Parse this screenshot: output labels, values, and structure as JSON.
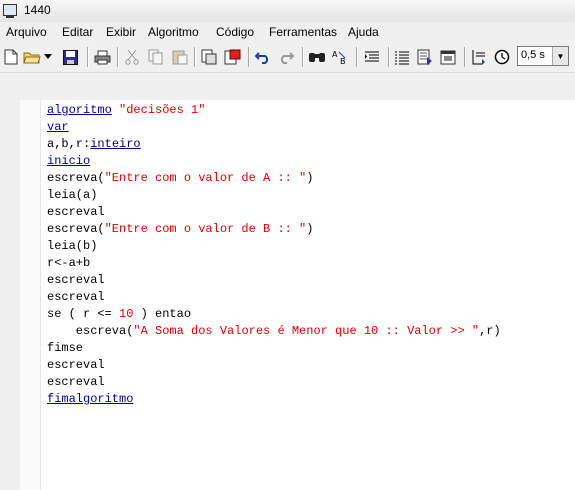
{
  "window": {
    "title": "1440"
  },
  "menu": [
    "Arquivo",
    "Editar",
    "Exibir",
    "Algoritmo",
    "Código",
    "Ferramentas",
    "Ajuda"
  ],
  "toolbar": {
    "icons": [
      "new-file-icon",
      "open-folder-icon",
      "dropdown-arrow-icon",
      "save-icon",
      "print-icon",
      "cut-icon",
      "copy-icon",
      "paste-icon",
      "copy-special-icon",
      "paste-special-icon",
      "undo-icon",
      "redo-icon",
      "find-icon",
      "replace-icon",
      "indent-icon",
      "list-icon",
      "export-icon",
      "window-icon",
      "step-icon",
      "timer-icon"
    ],
    "speed_value": "0,5 s"
  },
  "code": {
    "l1": {
      "kw": "algoritmo",
      "str": "\"decisões 1\""
    },
    "l2": {
      "kw": "var"
    },
    "l3": {
      "text": "a,b,r:",
      "kw": "inteiro"
    },
    "l4": {
      "kw": "inicio"
    },
    "l5": {
      "a": "escreva(",
      "str": "\"Entre com o valor de A :: \"",
      "b": ")"
    },
    "l6": {
      "text": "leia(a)"
    },
    "l7": {
      "text": "escreval"
    },
    "l8": {
      "a": "escreva(",
      "str": "\"Entre com o valor de B :: \"",
      "b": ")"
    },
    "l9": {
      "text": "leia(b)"
    },
    "l10": {
      "text": "r<-a+b"
    },
    "l11": {
      "text": "escreval"
    },
    "l12": {
      "text": "escreval"
    },
    "l13": {
      "a": "se ( r <= ",
      "num": "10",
      "b": " ) entao"
    },
    "l14": {
      "a": "    escreva(",
      "str": "\"A Soma dos Valores é Menor que 10 :: Valor >> \"",
      "b": ",r)"
    },
    "l15": {
      "text": "fimse"
    },
    "l16": {
      "text": "escreval"
    },
    "l17": {
      "text": "escreval"
    },
    "l18": {
      "kw": "fimalgoritmo"
    }
  }
}
